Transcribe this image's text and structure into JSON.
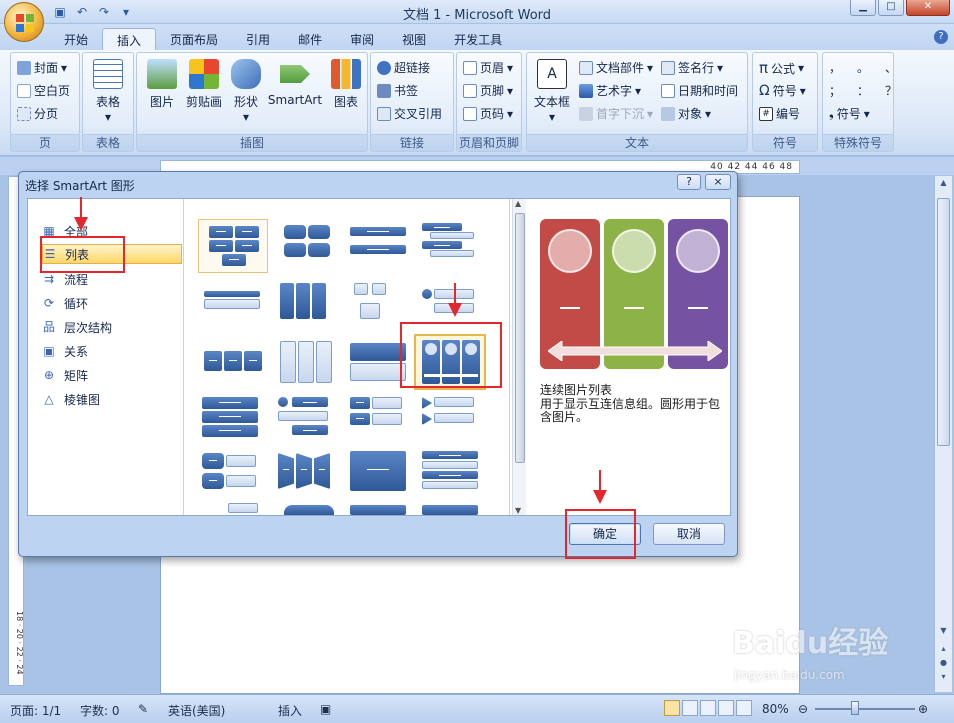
{
  "window": {
    "title": "文档 1 - Microsoft Word"
  },
  "tabs": [
    "开始",
    "插入",
    "页面布局",
    "引用",
    "邮件",
    "审阅",
    "视图",
    "开发工具"
  ],
  "active_tab": "插入",
  "ribbon": {
    "pages": {
      "label": "页",
      "items": [
        "封面",
        "空白页",
        "分页"
      ]
    },
    "table": {
      "label": "表格",
      "button": "表格"
    },
    "illustrations": {
      "label": "插图",
      "buttons": [
        "图片",
        "剪贴画",
        "形状",
        "SmartArt",
        "图表"
      ]
    },
    "links": {
      "label": "链接",
      "items": [
        "超链接",
        "书签",
        "交叉引用"
      ]
    },
    "header_footer": {
      "label": "页眉和页脚",
      "items": [
        "页眉",
        "页脚",
        "页码"
      ]
    },
    "text": {
      "label": "文本",
      "textbox": "文本框",
      "items_a": [
        "文档部件",
        "艺术字",
        "首字下沉"
      ],
      "items_b": [
        "签名行",
        "日期和时间",
        "对象"
      ]
    },
    "symbols": {
      "label": "符号",
      "items": [
        "公式",
        "符号",
        "编号"
      ]
    },
    "special": {
      "label": "特殊符号",
      "item": "符号",
      "glyphs": [
        "，",
        "。",
        "、",
        "；",
        "：",
        "？"
      ]
    }
  },
  "ruler": {
    "numbers": "40  42  44  46  48"
  },
  "vruler": {
    "numbers": "18 · 20 · 22 · 24"
  },
  "dialog": {
    "title": "选择 SmartArt 图形",
    "help": "?",
    "close": "×",
    "categories": [
      "全部",
      "列表",
      "流程",
      "循环",
      "层次结构",
      "关系",
      "矩阵",
      "棱锥图"
    ],
    "category_icons": [
      "▦",
      "☰",
      "⇉",
      "⟳",
      "品",
      "▣",
      "⊕",
      "△"
    ],
    "selected_category": "列表",
    "preview": {
      "name": "连续图片列表",
      "description": "用于显示互连信息组。圆形用于包含图片。",
      "colors": [
        "#c24a47",
        "#8db347",
        "#7653a2"
      ]
    },
    "ok_label": "确定",
    "cancel_label": "取消"
  },
  "statusbar": {
    "page": "页面: 1/1",
    "words": "字数: 0",
    "language": "英语(美国)",
    "mode": "插入",
    "zoom": "80%",
    "zoom_fraction": 0.4
  },
  "watermark": {
    "text": "Baidu经验",
    "sub": "jingyan.baidu.com"
  },
  "colors": {
    "accent": "#e5262c",
    "selection": "#ffd76a"
  }
}
